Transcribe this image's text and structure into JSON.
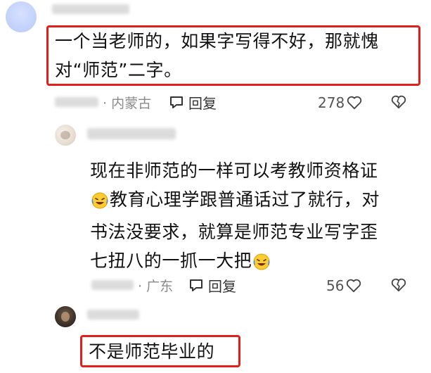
{
  "comments": [
    {
      "text_lines": [
        "一个当老师的，如果字写得不好，那就愧",
        "对“师范”二字。"
      ],
      "location": "· 内蒙古",
      "reply_label": "回复",
      "like_count": "278"
    },
    {
      "text_line1": "现在非师范的一样可以考教师资格证",
      "text_line2": "教育心理学跟普通话过了就行，对",
      "text_line3": "书法没要求，就算是师范专业写字歪",
      "text_line4": "七扭八的一抓一大把",
      "location": "· 广东",
      "reply_label": "回复",
      "like_count": "56"
    },
    {
      "text": "不是师范毕业的"
    }
  ],
  "colors": {
    "highlight_border": "#e0201c",
    "meta_text": "#8a8a8a"
  },
  "icons": [
    "comment-bubble-icon",
    "heart-outline-icon",
    "broken-heart-icon",
    "laughing-crying-emoji"
  ]
}
